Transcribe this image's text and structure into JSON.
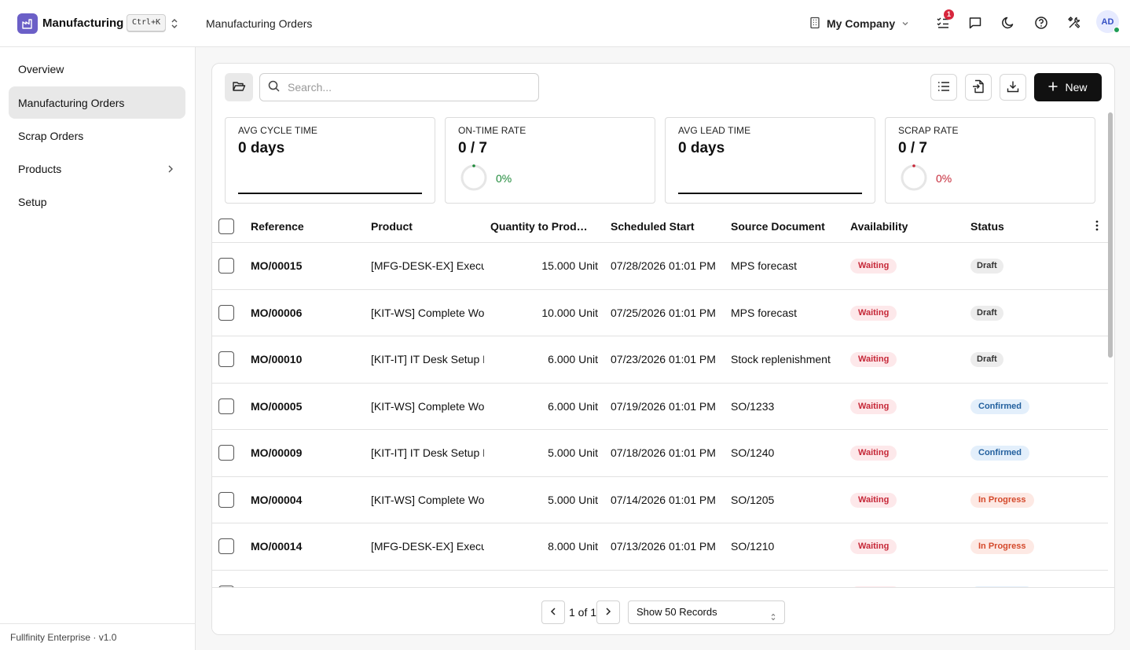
{
  "header": {
    "app_name": "Manufacturing",
    "shortcut": "Ctrl+K",
    "page_title": "Manufacturing Orders",
    "company": "My Company",
    "notification_count": "1",
    "avatar_initials": "AD"
  },
  "sidebar": {
    "items": [
      {
        "label": "Overview"
      },
      {
        "label": "Manufacturing Orders"
      },
      {
        "label": "Scrap Orders"
      },
      {
        "label": "Products"
      },
      {
        "label": "Setup"
      }
    ],
    "footer": "Fullfinity Enterprise · v1.0"
  },
  "toolbar": {
    "search_placeholder": "Search...",
    "new_label": "New"
  },
  "kpis": [
    {
      "label": "AVG CYCLE TIME",
      "value": "0 days"
    },
    {
      "label": "ON-TIME RATE",
      "value": "0 / 7",
      "percent": "0%",
      "color": "#1f8a3a"
    },
    {
      "label": "AVG LEAD TIME",
      "value": "0 days"
    },
    {
      "label": "SCRAP RATE",
      "value": "0 / 7",
      "percent": "0%",
      "color": "#c62838"
    }
  ],
  "table": {
    "columns": [
      "Reference",
      "Product",
      "Quantity to Produce",
      "Scheduled Start",
      "Source Document",
      "Availability",
      "Status"
    ],
    "rows": [
      {
        "ref": "MO/00015",
        "product": "[MFG-DESK-EX] Executive Desk",
        "qty": "15.000 Unit",
        "start": "07/28/2026 01:01 PM",
        "source": "MPS forecast",
        "availability": "Waiting",
        "status": "Draft"
      },
      {
        "ref": "MO/00006",
        "product": "[KIT-WS] Complete Workstation",
        "qty": "10.000 Unit",
        "start": "07/25/2026 01:01 PM",
        "source": "MPS forecast",
        "availability": "Waiting",
        "status": "Draft"
      },
      {
        "ref": "MO/00010",
        "product": "[KIT-IT] IT Desk Setup Kit",
        "qty": "6.000 Unit",
        "start": "07/23/2026 01:01 PM",
        "source": "Stock replenishment",
        "availability": "Waiting",
        "status": "Draft"
      },
      {
        "ref": "MO/00005",
        "product": "[KIT-WS] Complete Workstation",
        "qty": "6.000 Unit",
        "start": "07/19/2026 01:01 PM",
        "source": "SO/1233",
        "availability": "Waiting",
        "status": "Confirmed"
      },
      {
        "ref": "MO/00009",
        "product": "[KIT-IT] IT Desk Setup Kit",
        "qty": "5.000 Unit",
        "start": "07/18/2026 01:01 PM",
        "source": "SO/1240",
        "availability": "Waiting",
        "status": "Confirmed"
      },
      {
        "ref": "MO/00004",
        "product": "[KIT-WS] Complete Workstation",
        "qty": "5.000 Unit",
        "start": "07/14/2026 01:01 PM",
        "source": "SO/1205",
        "availability": "Waiting",
        "status": "In Progress"
      },
      {
        "ref": "MO/00014",
        "product": "[MFG-DESK-EX] Executive Desk",
        "qty": "8.000 Unit",
        "start": "07/13/2026 01:01 PM",
        "source": "SO/1210",
        "availability": "Waiting",
        "status": "In Progress"
      }
    ]
  },
  "pagination": {
    "page_text": "1 of 1",
    "page_size": "Show 50 Records"
  }
}
